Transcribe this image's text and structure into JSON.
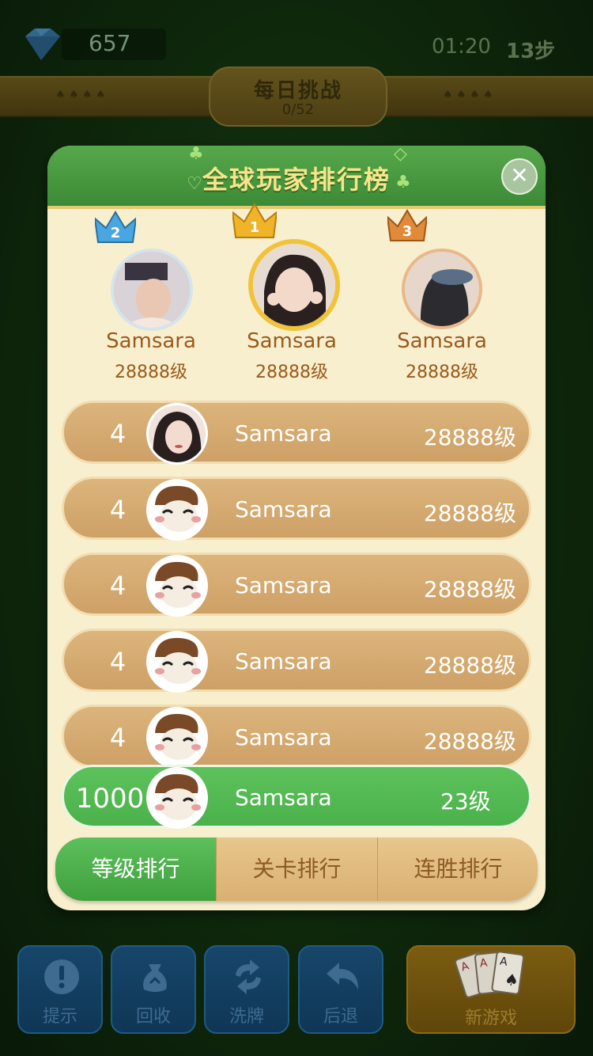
{
  "top": {
    "gems": "657",
    "timer": "01:20",
    "steps": "13步"
  },
  "banner": {
    "title": "每日挑战",
    "progress": "0/52"
  },
  "modal": {
    "title": "全球玩家排行榜",
    "close_icon": "close-icon"
  },
  "podium": [
    {
      "rank": "2",
      "name": "Samsara",
      "level": "28888级",
      "crown_color": "#4aa6e0"
    },
    {
      "rank": "1",
      "name": "Samsara",
      "level": "28888级",
      "crown_color": "#f0b429"
    },
    {
      "rank": "3",
      "name": "Samsara",
      "level": "28888级",
      "crown_color": "#e08a3a"
    }
  ],
  "rows": [
    {
      "rank": "4",
      "name": "Samsara",
      "level": "28888级"
    },
    {
      "rank": "4",
      "name": "Samsara",
      "level": "28888级"
    },
    {
      "rank": "4",
      "name": "Samsara",
      "level": "28888级"
    },
    {
      "rank": "4",
      "name": "Samsara",
      "level": "28888级"
    },
    {
      "rank": "4",
      "name": "Samsara",
      "level": "28888级"
    }
  ],
  "self_row": {
    "rank": "1000",
    "name": "Samsara",
    "level": "23级"
  },
  "tabs": [
    {
      "label": "等级排行",
      "active": true
    },
    {
      "label": "关卡排行",
      "active": false
    },
    {
      "label": "连胜排行",
      "active": false
    }
  ],
  "bottom_buttons": [
    {
      "label": "提示",
      "icon": "exclamation-icon"
    },
    {
      "label": "回收",
      "icon": "recycle-bag-icon"
    },
    {
      "label": "洗牌",
      "icon": "shuffle-icon"
    },
    {
      "label": "后退",
      "icon": "undo-icon"
    },
    {
      "label": "新游戏",
      "icon": "cards-icon"
    }
  ],
  "colors": {
    "accent_green": "#4bb14a",
    "row_tan": "#cda066",
    "title_gold": "#f8e48a"
  }
}
